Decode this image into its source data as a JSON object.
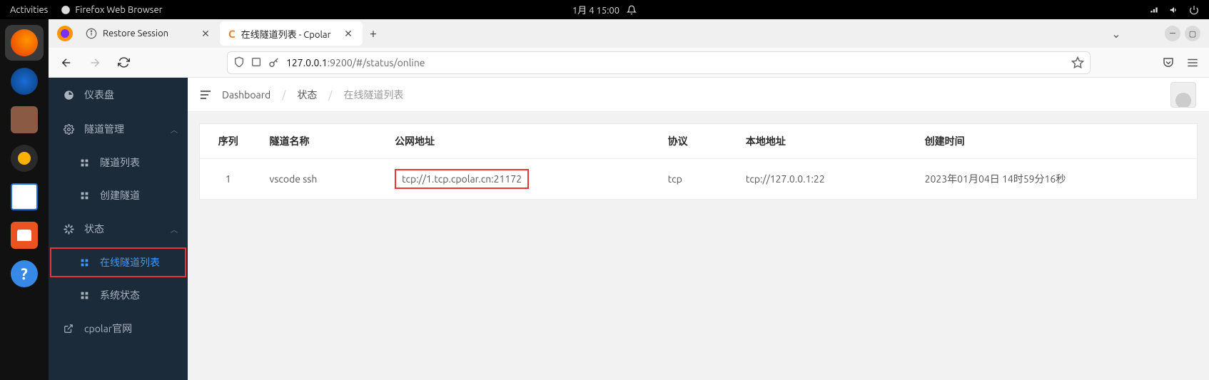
{
  "gnome": {
    "activities": "Activities",
    "app_label": "Firefox Web Browser",
    "clock": "1月 4  15:00"
  },
  "browser": {
    "tabs": [
      {
        "title": "Restore Session",
        "active": false
      },
      {
        "title": "在线隧道列表 - Cpolar",
        "active": true
      }
    ],
    "url_host": "127.0.0.1",
    "url_path": ":9200/#/status/online"
  },
  "sidebar": {
    "dashboard": "仪表盘",
    "tunnel_mgmt": "隧道管理",
    "tunnel_list": "隧道列表",
    "create_tunnel": "创建隧道",
    "status": "状态",
    "online_list": "在线隧道列表",
    "sys_status": "系统状态",
    "cpolar_site": "cpolar官网"
  },
  "breadcrumb": {
    "root": "Dashboard",
    "l1": "状态",
    "l2": "在线隧道列表"
  },
  "table": {
    "headers": {
      "seq": "序列",
      "name": "隧道名称",
      "public": "公网地址",
      "proto": "协议",
      "local": "本地地址",
      "created": "创建时间"
    },
    "rows": [
      {
        "seq": "1",
        "name": "vscode ssh",
        "public": "tcp://1.tcp.cpolar.cn:21172",
        "proto": "tcp",
        "local": "tcp://127.0.0.1:22",
        "created": "2023年01月04日 14时59分16秒"
      }
    ]
  }
}
